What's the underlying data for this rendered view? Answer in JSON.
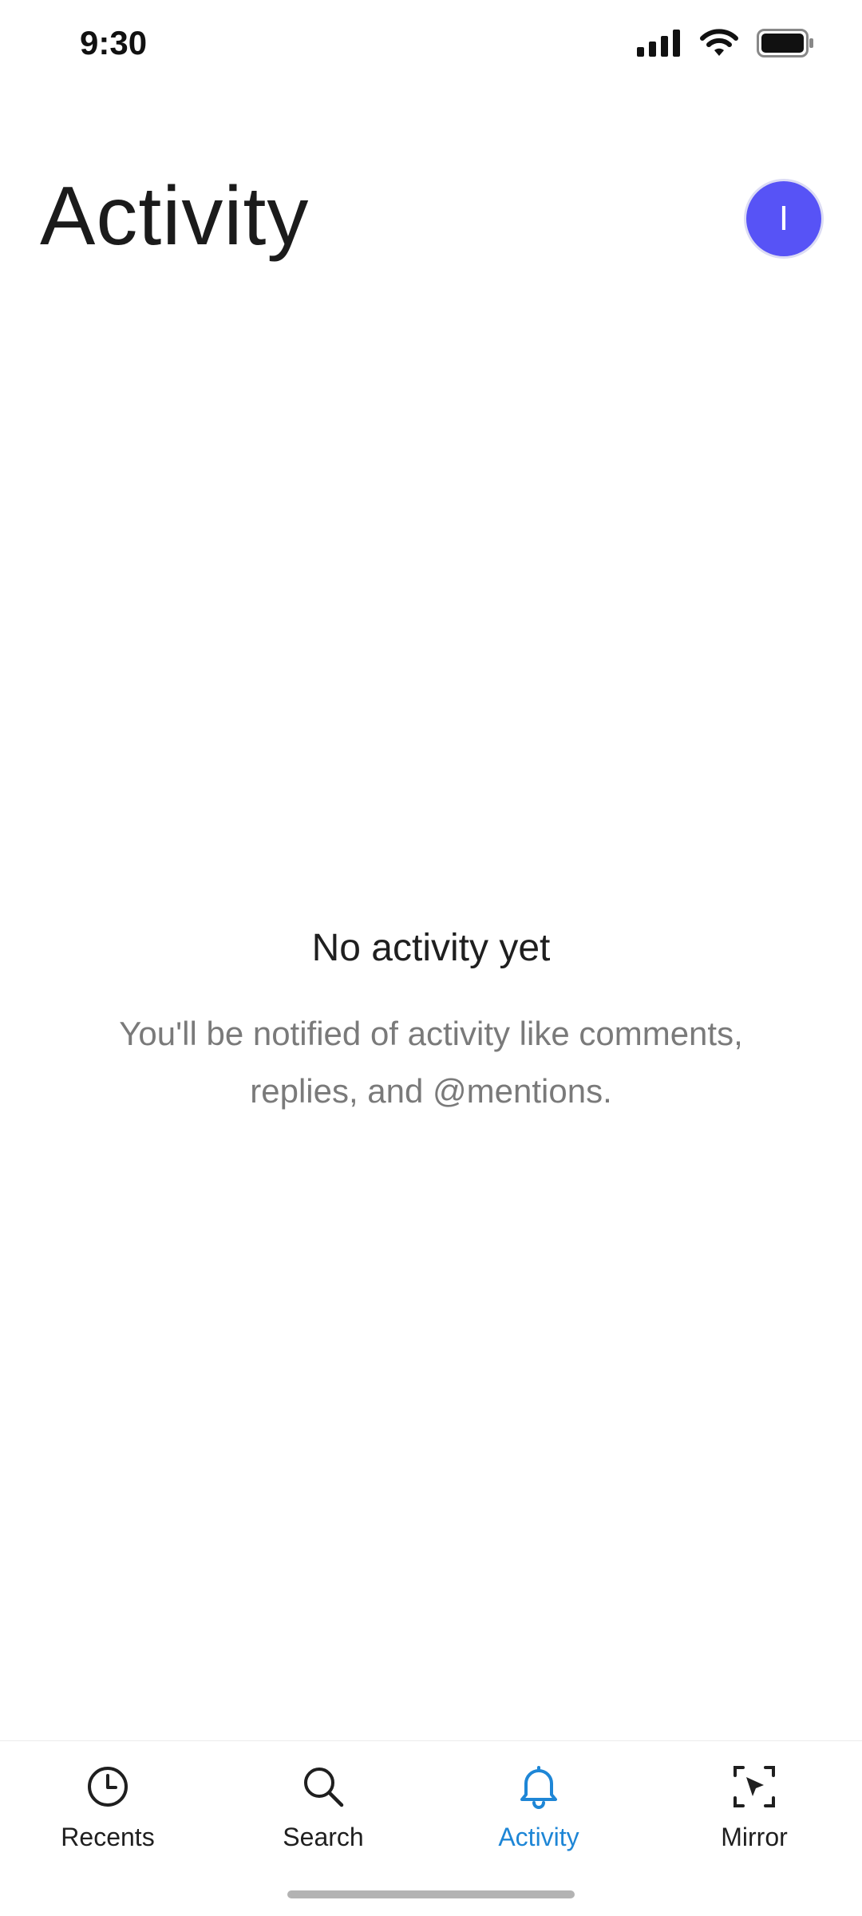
{
  "status_bar": {
    "time": "9:30"
  },
  "header": {
    "title": "Activity",
    "avatar_initial": "I"
  },
  "empty_state": {
    "title": "No activity yet",
    "description": "You'll be notified of activity like comments, replies, and @mentions."
  },
  "tabs": [
    {
      "label": "Recents",
      "icon": "clock-icon",
      "active": false
    },
    {
      "label": "Search",
      "icon": "search-icon",
      "active": false
    },
    {
      "label": "Activity",
      "icon": "bell-icon",
      "active": true
    },
    {
      "label": "Mirror",
      "icon": "mirror-cursor-icon",
      "active": false
    }
  ],
  "colors": {
    "accent": "#1e86d6",
    "avatar": "#5753f6",
    "text_primary": "#1f1f1f",
    "text_secondary": "#7a7a7a"
  }
}
